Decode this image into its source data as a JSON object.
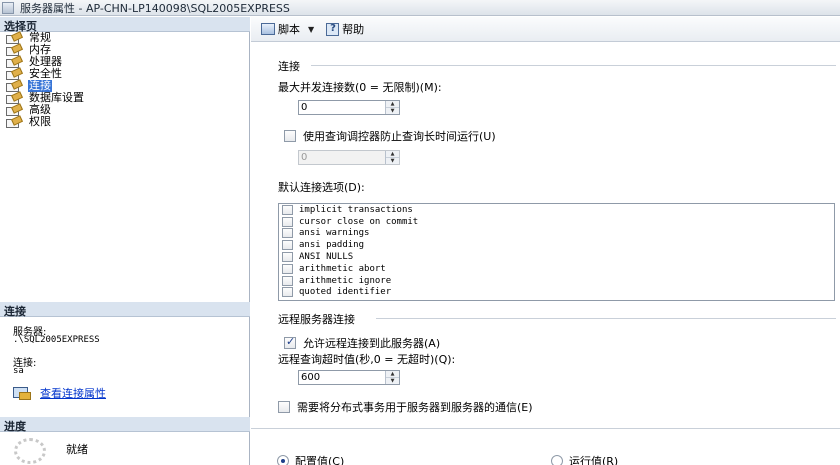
{
  "window": {
    "title": "服务器属性 - AP-CHN-LP140098\\SQL2005EXPRESS"
  },
  "left": {
    "select_page_header": "选择页",
    "pages": [
      {
        "label": "常规",
        "selected": false
      },
      {
        "label": "内存",
        "selected": false
      },
      {
        "label": "处理器",
        "selected": false
      },
      {
        "label": "安全性",
        "selected": false
      },
      {
        "label": "连接",
        "selected": true
      },
      {
        "label": "数据库设置",
        "selected": false
      },
      {
        "label": "高级",
        "selected": false
      },
      {
        "label": "权限",
        "selected": false
      }
    ],
    "connection_header": "连接",
    "server_label": "服务器:",
    "server_value": ".\\SQL2005EXPRESS",
    "conn_label": "连接:",
    "conn_value": "sa",
    "view_conn_link": "查看连接属性",
    "progress_header": "进度",
    "progress_status": "就绪"
  },
  "toolbar": {
    "script_label": "脚本",
    "help_label": "帮助"
  },
  "form": {
    "connections_group": "连接",
    "max_conn_label": "最大并发连接数(0 = 无限制)(M):",
    "max_conn_value": "0",
    "query_governor_label": "使用查询调控器防止查询长时间运行(U)",
    "query_governor_checked": false,
    "query_governor_value": "0",
    "default_options_label": "默认连接选项(D):",
    "default_options": [
      {
        "label": "implicit transactions",
        "checked": false
      },
      {
        "label": "cursor close on commit",
        "checked": false
      },
      {
        "label": "ansi warnings",
        "checked": false
      },
      {
        "label": "ansi padding",
        "checked": false
      },
      {
        "label": "ANSI NULLS",
        "checked": false
      },
      {
        "label": "arithmetic abort",
        "checked": false
      },
      {
        "label": "arithmetic ignore",
        "checked": false
      },
      {
        "label": "quoted identifier",
        "checked": false
      }
    ],
    "remote_group": "远程服务器连接",
    "allow_remote_label": "允许远程连接到此服务器(A)",
    "allow_remote_checked": true,
    "remote_timeout_label": "远程查询超时值(秒,0 = 无超时)(Q):",
    "remote_timeout_value": "600",
    "distributed_label": "需要将分布式事务用于服务器到服务器的通信(E)",
    "distributed_checked": false,
    "radio_configured": "配置值(C)",
    "radio_running": "运行值(R)",
    "radio_selected": "configured"
  }
}
